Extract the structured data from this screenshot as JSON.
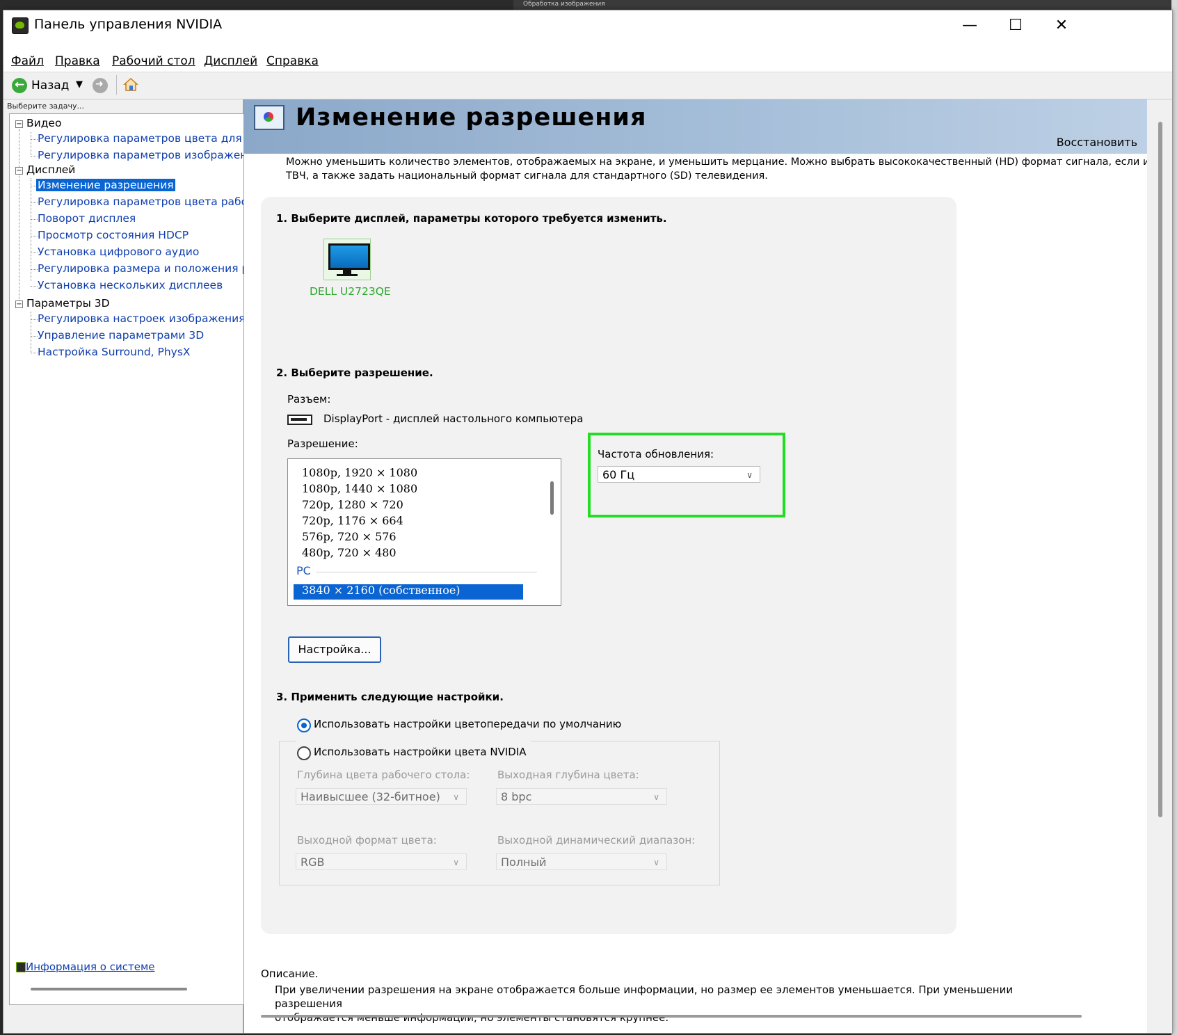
{
  "background": {
    "behind_window_text": "Обработка изображения"
  },
  "window": {
    "title": "Панель управления NVIDIA",
    "controls": {
      "minimize": "—",
      "maximize": "☐",
      "close": "✕"
    }
  },
  "menu": [
    "Файл",
    "Правка",
    "Рабочий стол",
    "Дисплей",
    "Справка"
  ],
  "toolbar": {
    "back_label": "Назад",
    "back_dropdown": "▼",
    "forward": "➜"
  },
  "sidebar": {
    "hint": "Выберите задачу...",
    "groups": [
      {
        "label": "Видео",
        "toggle": "−",
        "items": [
          "Регулировка параметров цвета для видео",
          "Регулировка параметров изображения для видео"
        ]
      },
      {
        "label": "Дисплей",
        "toggle": "−",
        "items": [
          "Изменение разрешения",
          "Регулировка параметров цвета рабочего стола",
          "Поворот дисплея",
          "Просмотр состояния HDCP",
          "Установка цифрового аудио",
          "Регулировка размера и положения рабочего стола",
          "Установка нескольких дисплеев"
        ]
      },
      {
        "label": "Параметры 3D",
        "toggle": "−",
        "items": [
          "Регулировка настроек изображения с просмотром",
          "Управление параметрами 3D",
          "Настройка Surround, PhysX"
        ]
      }
    ],
    "selected": "Изменение разрешения",
    "system_info": "Информация о системе"
  },
  "page": {
    "title": "Изменение разрешения",
    "restore": "Восстановить",
    "intro_line1": "Можно уменьшить количество элементов, отображаемых на экране, и уменьшить мерцание. Можно выбрать высококачественный (HD) формат сигнала, если исп",
    "intro_line2": "ТВЧ, а также задать национальный формат сигнала для стандартного (SD) телевидения.",
    "step1": "1. Выберите дисплей, параметры которого требуется изменить.",
    "display_name": "DELL U2723QE",
    "step2": "2. Выберите разрешение.",
    "connector_label": "Разъем:",
    "connector_value": "DisplayPort - дисплей настольного компьютера",
    "resolution_label": "Разрешение:",
    "resolutions": [
      "1080p, 1920 × 1080",
      "1080p, 1440 × 1080",
      "720p, 1280 × 720",
      "720p, 1176 × 664",
      "576p, 720 × 576",
      "480p, 720 × 480"
    ],
    "pc_group": "PC",
    "selected_resolution": "3840 × 2160 (собственное)",
    "customize_button": "Настройка...",
    "refresh_label": "Частота обновления:",
    "refresh_value": "60 Гц",
    "step3": "3. Применить следующие настройки.",
    "radio_default": "Использовать настройки цветопередачи по умолчанию",
    "radio_nvidia": "Использовать настройки цвета NVIDIA",
    "desktop_depth_label": "Глубина цвета рабочего стола:",
    "desktop_depth_value": "Наивысшее (32-битное)",
    "output_depth_label": "Выходная глубина цвета:",
    "output_depth_value": "8 bpc",
    "output_format_label": "Выходной формат цвета:",
    "output_format_value": "RGB",
    "dynamic_range_label": "Выходной динамический диапазон:",
    "dynamic_range_value": "Полный",
    "description_label": "Описание.",
    "description_line1": "При увеличении разрешения на экране отображается больше информации, но размер ее элементов уменьшается. При уменьшении разрешения",
    "description_line2": "отображается меньше информации, но элементы становятся крупнее."
  }
}
